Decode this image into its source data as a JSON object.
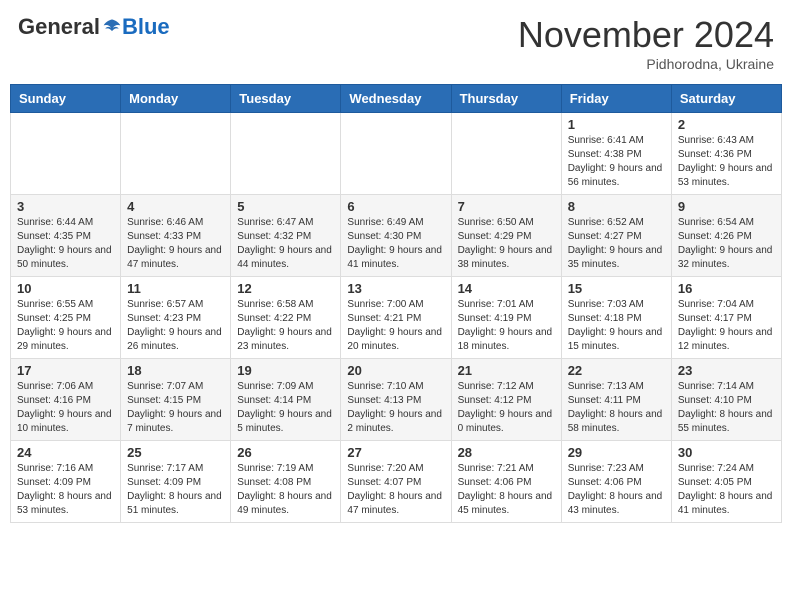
{
  "header": {
    "logo_general": "General",
    "logo_blue": "Blue",
    "month_title": "November 2024",
    "location": "Pidhorodna, Ukraine"
  },
  "calendar": {
    "days_of_week": [
      "Sunday",
      "Monday",
      "Tuesday",
      "Wednesday",
      "Thursday",
      "Friday",
      "Saturday"
    ],
    "weeks": [
      [
        {
          "day": "",
          "info": ""
        },
        {
          "day": "",
          "info": ""
        },
        {
          "day": "",
          "info": ""
        },
        {
          "day": "",
          "info": ""
        },
        {
          "day": "",
          "info": ""
        },
        {
          "day": "1",
          "info": "Sunrise: 6:41 AM\nSunset: 4:38 PM\nDaylight: 9 hours and 56 minutes."
        },
        {
          "day": "2",
          "info": "Sunrise: 6:43 AM\nSunset: 4:36 PM\nDaylight: 9 hours and 53 minutes."
        }
      ],
      [
        {
          "day": "3",
          "info": "Sunrise: 6:44 AM\nSunset: 4:35 PM\nDaylight: 9 hours and 50 minutes."
        },
        {
          "day": "4",
          "info": "Sunrise: 6:46 AM\nSunset: 4:33 PM\nDaylight: 9 hours and 47 minutes."
        },
        {
          "day": "5",
          "info": "Sunrise: 6:47 AM\nSunset: 4:32 PM\nDaylight: 9 hours and 44 minutes."
        },
        {
          "day": "6",
          "info": "Sunrise: 6:49 AM\nSunset: 4:30 PM\nDaylight: 9 hours and 41 minutes."
        },
        {
          "day": "7",
          "info": "Sunrise: 6:50 AM\nSunset: 4:29 PM\nDaylight: 9 hours and 38 minutes."
        },
        {
          "day": "8",
          "info": "Sunrise: 6:52 AM\nSunset: 4:27 PM\nDaylight: 9 hours and 35 minutes."
        },
        {
          "day": "9",
          "info": "Sunrise: 6:54 AM\nSunset: 4:26 PM\nDaylight: 9 hours and 32 minutes."
        }
      ],
      [
        {
          "day": "10",
          "info": "Sunrise: 6:55 AM\nSunset: 4:25 PM\nDaylight: 9 hours and 29 minutes."
        },
        {
          "day": "11",
          "info": "Sunrise: 6:57 AM\nSunset: 4:23 PM\nDaylight: 9 hours and 26 minutes."
        },
        {
          "day": "12",
          "info": "Sunrise: 6:58 AM\nSunset: 4:22 PM\nDaylight: 9 hours and 23 minutes."
        },
        {
          "day": "13",
          "info": "Sunrise: 7:00 AM\nSunset: 4:21 PM\nDaylight: 9 hours and 20 minutes."
        },
        {
          "day": "14",
          "info": "Sunrise: 7:01 AM\nSunset: 4:19 PM\nDaylight: 9 hours and 18 minutes."
        },
        {
          "day": "15",
          "info": "Sunrise: 7:03 AM\nSunset: 4:18 PM\nDaylight: 9 hours and 15 minutes."
        },
        {
          "day": "16",
          "info": "Sunrise: 7:04 AM\nSunset: 4:17 PM\nDaylight: 9 hours and 12 minutes."
        }
      ],
      [
        {
          "day": "17",
          "info": "Sunrise: 7:06 AM\nSunset: 4:16 PM\nDaylight: 9 hours and 10 minutes."
        },
        {
          "day": "18",
          "info": "Sunrise: 7:07 AM\nSunset: 4:15 PM\nDaylight: 9 hours and 7 minutes."
        },
        {
          "day": "19",
          "info": "Sunrise: 7:09 AM\nSunset: 4:14 PM\nDaylight: 9 hours and 5 minutes."
        },
        {
          "day": "20",
          "info": "Sunrise: 7:10 AM\nSunset: 4:13 PM\nDaylight: 9 hours and 2 minutes."
        },
        {
          "day": "21",
          "info": "Sunrise: 7:12 AM\nSunset: 4:12 PM\nDaylight: 9 hours and 0 minutes."
        },
        {
          "day": "22",
          "info": "Sunrise: 7:13 AM\nSunset: 4:11 PM\nDaylight: 8 hours and 58 minutes."
        },
        {
          "day": "23",
          "info": "Sunrise: 7:14 AM\nSunset: 4:10 PM\nDaylight: 8 hours and 55 minutes."
        }
      ],
      [
        {
          "day": "24",
          "info": "Sunrise: 7:16 AM\nSunset: 4:09 PM\nDaylight: 8 hours and 53 minutes."
        },
        {
          "day": "25",
          "info": "Sunrise: 7:17 AM\nSunset: 4:09 PM\nDaylight: 8 hours and 51 minutes."
        },
        {
          "day": "26",
          "info": "Sunrise: 7:19 AM\nSunset: 4:08 PM\nDaylight: 8 hours and 49 minutes."
        },
        {
          "day": "27",
          "info": "Sunrise: 7:20 AM\nSunset: 4:07 PM\nDaylight: 8 hours and 47 minutes."
        },
        {
          "day": "28",
          "info": "Sunrise: 7:21 AM\nSunset: 4:06 PM\nDaylight: 8 hours and 45 minutes."
        },
        {
          "day": "29",
          "info": "Sunrise: 7:23 AM\nSunset: 4:06 PM\nDaylight: 8 hours and 43 minutes."
        },
        {
          "day": "30",
          "info": "Sunrise: 7:24 AM\nSunset: 4:05 PM\nDaylight: 8 hours and 41 minutes."
        }
      ]
    ]
  }
}
